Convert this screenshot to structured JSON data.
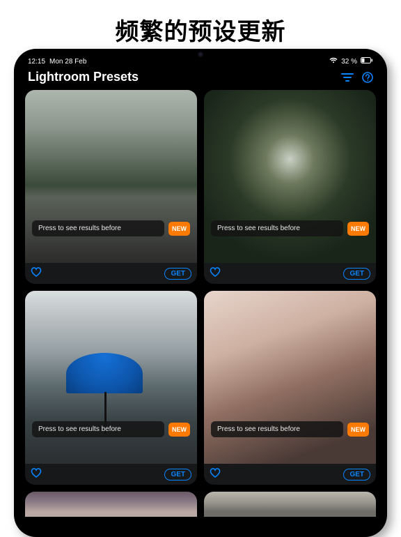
{
  "headline": "频繁的预设更新",
  "status": {
    "time": "12:15",
    "date": "Mon 28 Feb",
    "battery_text": "32 %"
  },
  "header": {
    "title": "Lightroom Presets"
  },
  "common": {
    "press_label": "Press to see results before",
    "new_label": "NEW",
    "get_label": "GET"
  },
  "colors": {
    "accent": "#0a84ff",
    "new_badge": "#ff7a00"
  }
}
